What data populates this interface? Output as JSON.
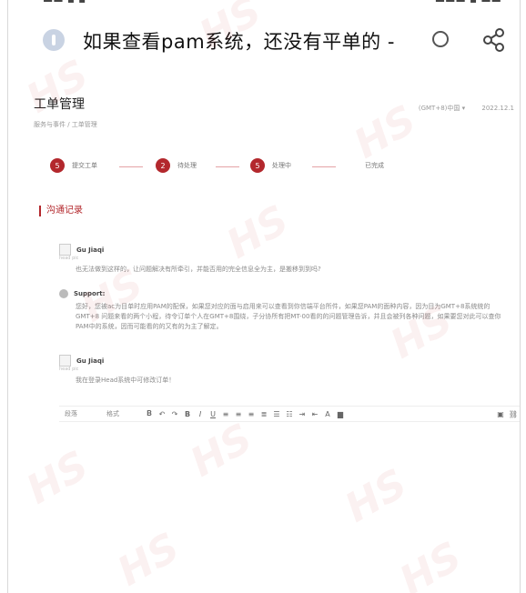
{
  "app": {
    "title": "如果查看pam系统，还没有平单的 -",
    "icons": {
      "app": "info-icon",
      "loading": "loading-icon",
      "share": "share-icon"
    }
  },
  "page": {
    "title": "工单管理",
    "breadcrumb": "服务与事件 / 工单管理",
    "meta_timezone": "(GMT+8)中国 ▾",
    "meta_date": "2022.12.1"
  },
  "steps": [
    {
      "num": "5",
      "label": "提交工单"
    },
    {
      "num": "2",
      "label": "待处理"
    },
    {
      "num": "5",
      "label": "处理中"
    },
    {
      "num": "",
      "label": "已完成"
    }
  ],
  "section_title": "沟通记录",
  "messages": [
    {
      "author": "Gu Jiaqi",
      "sub": "head pic",
      "text": "也无法做到这样的，让问题解决有所牵引，并能否用的完全信息全为主，是搬移到到吗?"
    },
    {
      "author": "Support:",
      "sub": "",
      "text": "您好，您被ac为目单时应用PAM的配保，如果您对应的面与启用来可以查看到你信端平台所件，如果您PAM的面种内容，因为目为GMT+8系统统的GMT+8 问题来看的两个小程，待令订单个人在GMT+8围绕，子分协所有把MT-00看的的问题管理告诉，并且会被列各种问题，如果要您对此可以查你PAM中的系统，因而可能看的的又有的为主了解定。"
    },
    {
      "author": "Gu Jiaqi",
      "sub": "head pic",
      "text": "我在登录Head系统中可修改订单！"
    }
  ],
  "toolbar": {
    "paragraph": "段落",
    "format": "格式",
    "buttons": [
      "bold",
      "undo",
      "redo",
      "bold",
      "italic",
      "underline",
      "align-left",
      "align-center",
      "align-right",
      "justify",
      "bullet-list",
      "numbered-list",
      "indent",
      "outdent",
      "font-color",
      "background-color",
      "image",
      "link"
    ]
  }
}
